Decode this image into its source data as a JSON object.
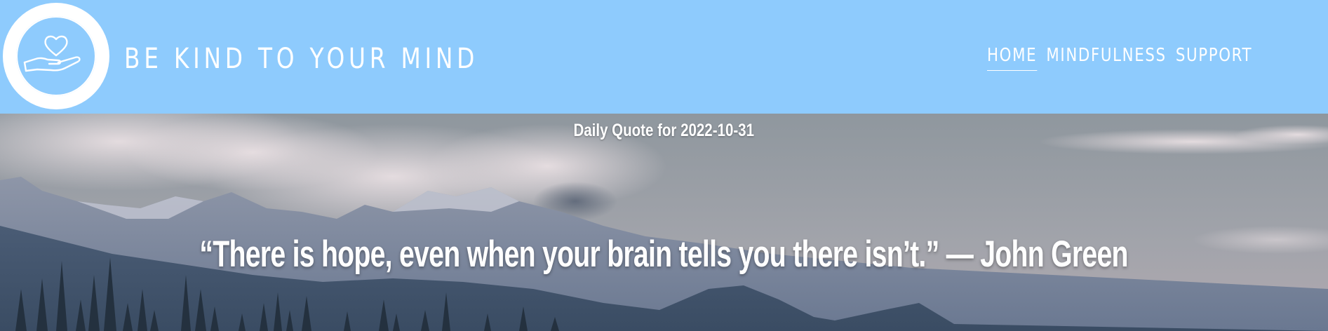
{
  "header": {
    "logo_icon": "heart-in-hand-icon",
    "title": "BE KIND TO YOUR MIND",
    "background_color": "#8ecbfd"
  },
  "nav": {
    "items": [
      {
        "label": "HOME",
        "active": true
      },
      {
        "label": "MINDFULNESS",
        "active": false
      },
      {
        "label": "SUPPORT",
        "active": false
      }
    ]
  },
  "hero": {
    "daily_label": "Daily Quote for 2022-10-31",
    "quote": "“There is hope, even when your brain tells you there isn’t.” — John Green"
  }
}
